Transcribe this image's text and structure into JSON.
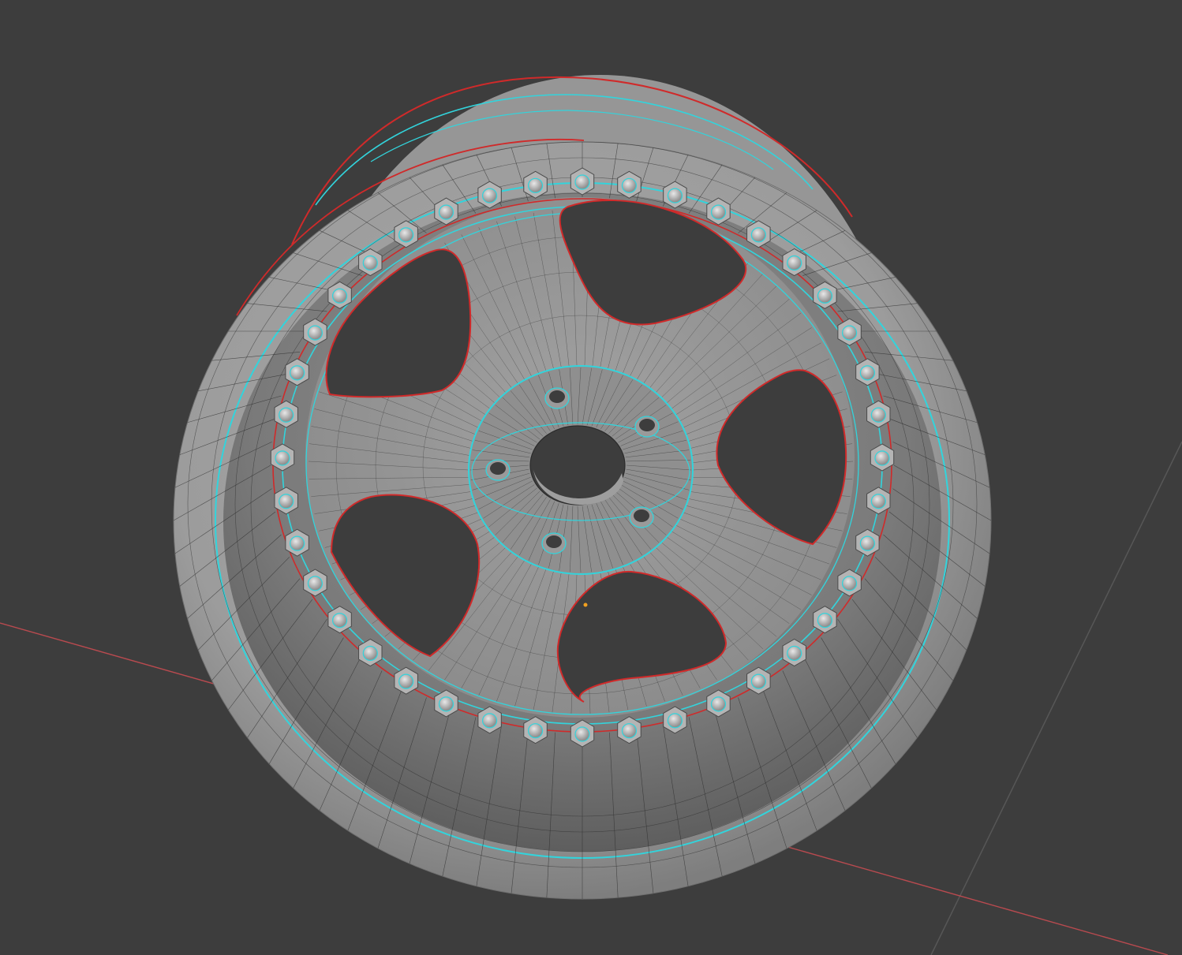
{
  "viewport": {
    "background": "#3d3d3d",
    "grid_line_color": "#565656",
    "x_axis_color": "#b94a4f"
  },
  "model": {
    "object": "wheel-rim",
    "shading": "solid-gray-with-wireframe",
    "surface_color": "#9a9a9a",
    "wire_color": "#2b2b2b",
    "seam_color": "#d02a2a",
    "highlight_color": "#32d4dc",
    "spoke_count": 5,
    "lug_hole_count": 5,
    "rim_bolt_count": 40
  }
}
